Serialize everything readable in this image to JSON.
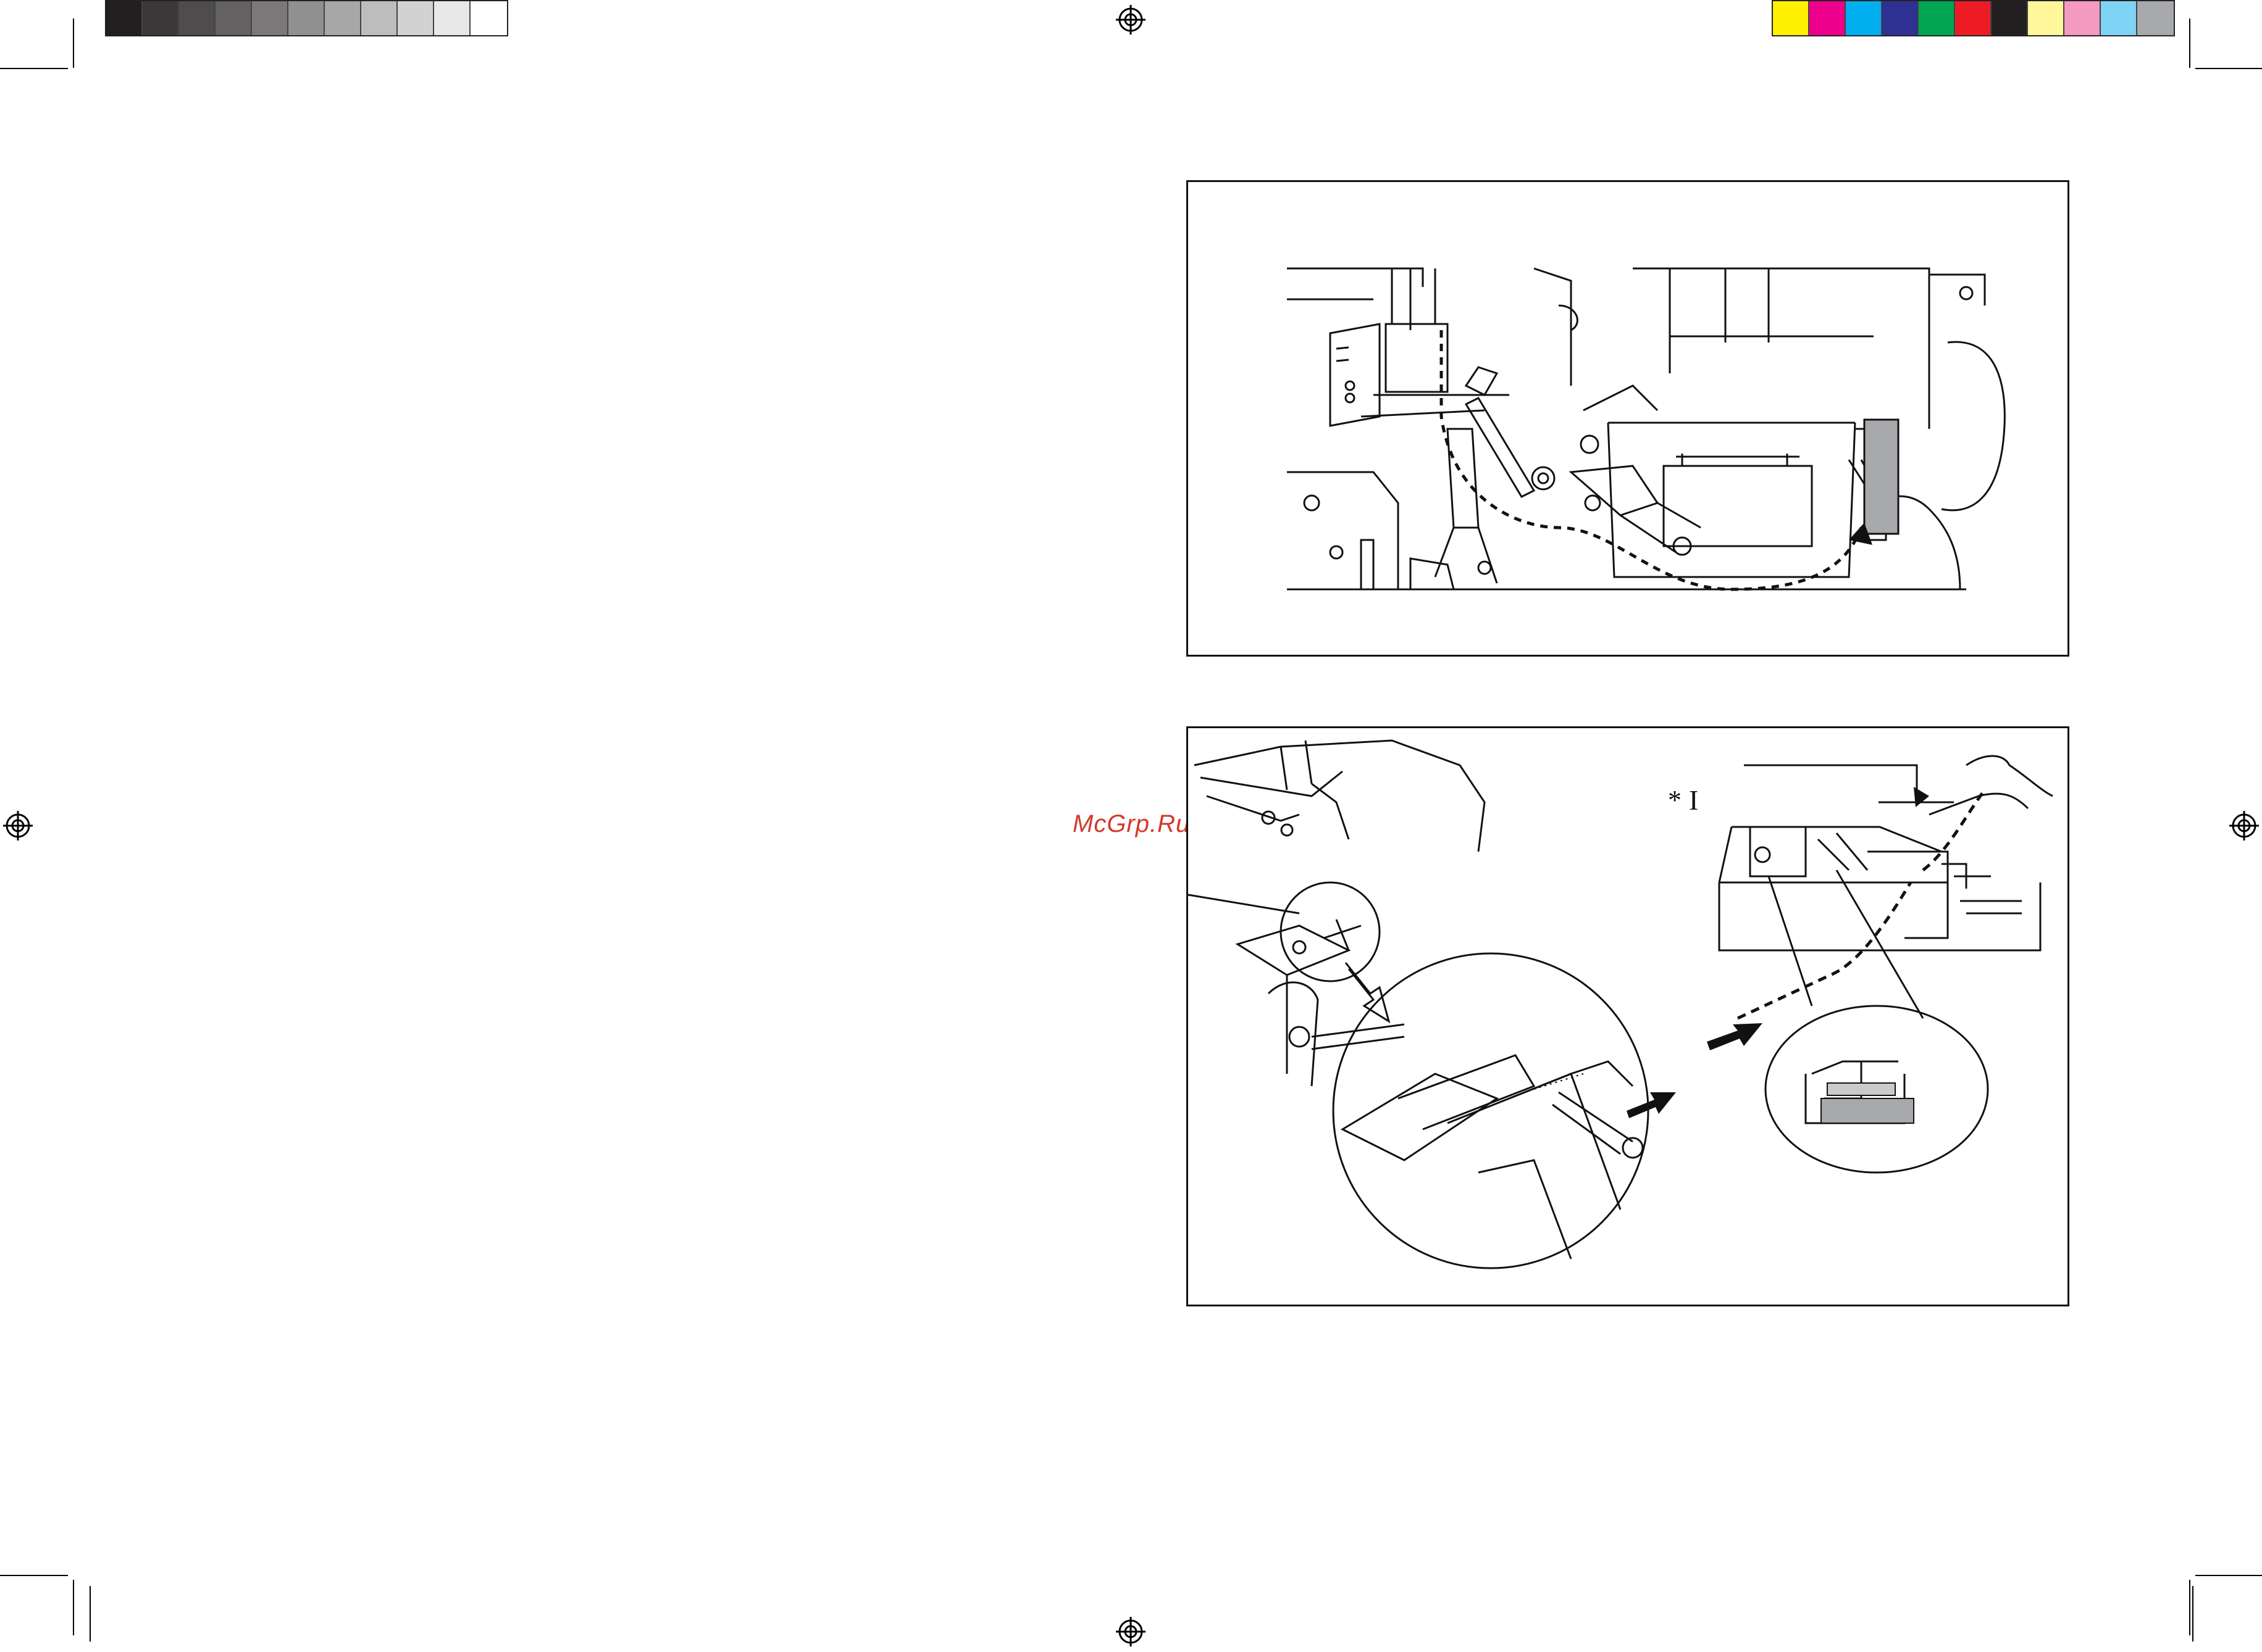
{
  "print_marks": {
    "grayscale_strip": [
      "#231f20",
      "#3a3839",
      "#4e4c4d",
      "#636162",
      "#7a7879",
      "#919090",
      "#a8a7a7",
      "#bebdbd",
      "#d3d2d2",
      "#e8e8e8",
      "#ffffff"
    ],
    "color_strip": [
      "#fff200",
      "#ec008c",
      "#00aeef",
      "#2e3192",
      "#00a651",
      "#ed1c24",
      "#231f20",
      "#fff799",
      "#f49ac1",
      "#7fd3f5",
      "#a7a9ac"
    ]
  },
  "watermark": "McGrp.Ru",
  "figure_bottom": {
    "callout_marker": "*",
    "callout_label": "I"
  }
}
